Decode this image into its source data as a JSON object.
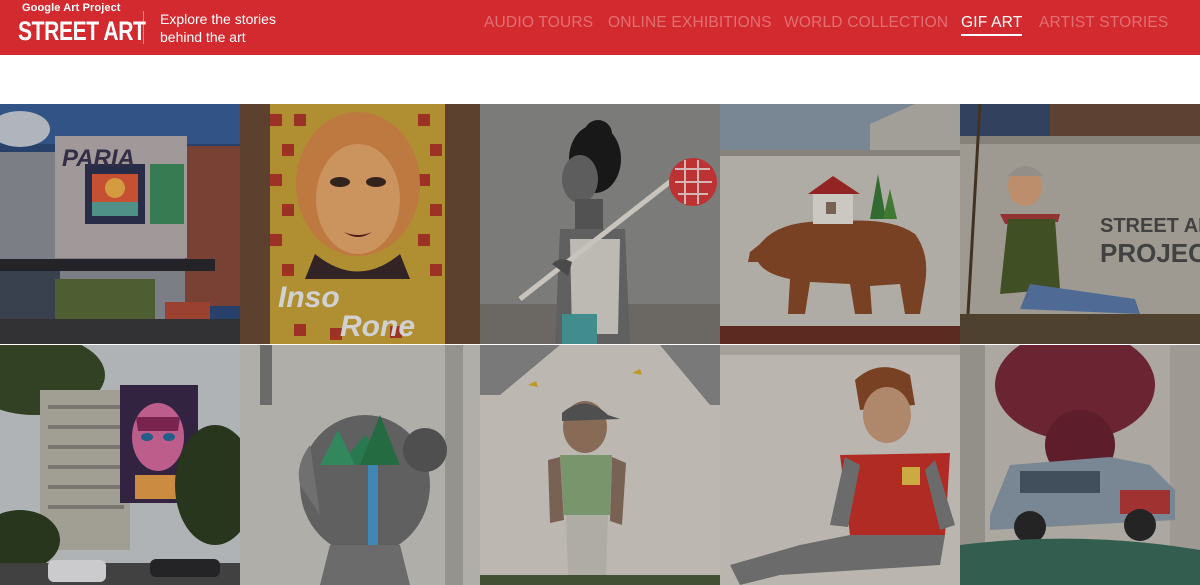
{
  "header": {
    "logo_top": "Google Art Project",
    "logo_main": "STREET ART",
    "tagline_line1": "Explore the stories",
    "tagline_line2": "behind the art",
    "brand_color": "#d32a2f"
  },
  "nav": {
    "items": [
      {
        "label": "AUDIO TOURS",
        "active": false
      },
      {
        "label": "ONLINE EXHIBITIONS",
        "active": false
      },
      {
        "label": "WORLD COLLECTION",
        "active": false
      },
      {
        "label": "GIF ART",
        "active": true
      },
      {
        "label": "ARTIST STORIES",
        "active": false
      }
    ]
  },
  "gallery": {
    "artworks": [
      {
        "wall_text": "PARIA"
      },
      {
        "wall_text_1": "Inso",
        "wall_text_2": "Rone"
      },
      {},
      {},
      {
        "watermark_1": "STREET ART",
        "watermark_2": "PROJECT"
      },
      {},
      {},
      {},
      {},
      {}
    ]
  }
}
